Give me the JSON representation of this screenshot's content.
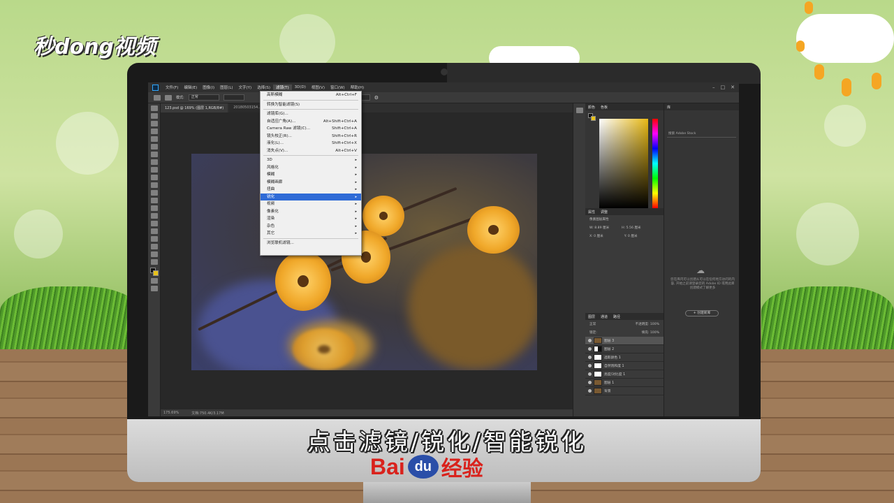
{
  "brand": {
    "watermark": "秒dong视频"
  },
  "ps": {
    "menubar": [
      "文件(F)",
      "编辑(E)",
      "图像(I)",
      "图层(L)",
      "文字(Y)",
      "选择(S)",
      "滤镜(T)",
      "3D(D)",
      "视图(V)",
      "窗口(W)",
      "帮助(H)"
    ],
    "active_menu": "滤镜(T)",
    "mode_label": "模式:",
    "mode_value": "正常",
    "tabs": [
      "123.psd @ 169% (图层 1,RGB/8#)",
      "20180503154..."
    ],
    "status_zoom": "175.69%",
    "status_doc": "文档:750.4K/3.17M"
  },
  "filter_menu": {
    "items": [
      {
        "label": "高斯模糊",
        "shortcut": "Alt+Ctrl+F"
      },
      {
        "sep": true
      },
      {
        "label": "转换为智能滤镜(S)",
        "shortcut": ""
      },
      {
        "sep": true
      },
      {
        "label": "滤镜库(G)...",
        "shortcut": ""
      },
      {
        "label": "自适应广角(A)...",
        "shortcut": "Alt+Shift+Ctrl+A"
      },
      {
        "label": "Camera Raw 滤镜(C)...",
        "shortcut": "Shift+Ctrl+A"
      },
      {
        "label": "镜头校正(R)...",
        "shortcut": "Shift+Ctrl+R"
      },
      {
        "label": "液化(L)...",
        "shortcut": "Shift+Ctrl+X"
      },
      {
        "label": "消失点(V)...",
        "shortcut": "Alt+Ctrl+V"
      },
      {
        "sep": true
      },
      {
        "label": "3D",
        "submenu": true
      },
      {
        "label": "风格化",
        "submenu": true
      },
      {
        "label": "模糊",
        "submenu": true
      },
      {
        "label": "模糊画廊",
        "submenu": true
      },
      {
        "label": "扭曲",
        "submenu": true
      },
      {
        "label": "锐化",
        "submenu": true,
        "highlighted": true
      },
      {
        "label": "视频",
        "submenu": true
      },
      {
        "label": "像素化",
        "submenu": true
      },
      {
        "label": "渲染",
        "submenu": true
      },
      {
        "label": "杂色",
        "submenu": true
      },
      {
        "label": "其它",
        "submenu": true
      },
      {
        "sep": true
      },
      {
        "label": "浏览联机滤镜...",
        "shortcut": ""
      }
    ]
  },
  "panels": {
    "color_tabs": [
      "颜色",
      "色板"
    ],
    "props_tabs": [
      "属性",
      "调整"
    ],
    "props_title": "像素图层属性",
    "props_w": "W: 8.89 厘米",
    "props_h": "H: 5.56 厘米",
    "props_x": "X: 0 厘米",
    "props_y": "Y: 0 厘米",
    "layers_tabs": [
      "图层",
      "通道",
      "路径"
    ],
    "blend_mode": "正常",
    "opacity": "不透明度: 100%",
    "fill": "填充: 100%",
    "lock": "锁定:",
    "layers": [
      {
        "name": "图层 3",
        "thumb": "photo",
        "selected": true
      },
      {
        "name": "图层 2",
        "thumb": "mask"
      },
      {
        "name": "选取颜色 1",
        "thumb": "white"
      },
      {
        "name": "自然饱和度 1",
        "thumb": "white"
      },
      {
        "name": "亮度/对比度 1",
        "thumb": "white"
      },
      {
        "name": "图层 1",
        "thumb": "photo"
      },
      {
        "name": "背景",
        "thumb": "photo"
      }
    ],
    "lib_tabs": [
      "库"
    ],
    "lib_search": "搜索 Adobe Stock",
    "lib_text": "您在库内可以创建从可以在任何地方访问的内容, 开始之前请登录您的 Adobe ID 或用此库创建模式了解更多",
    "lib_button": "+ 创建新库"
  },
  "subtitle": "点击滤镜/锐化/智能锐化",
  "footer": {
    "baidu": "Bai",
    "du": "du",
    "jingyan": "经验"
  }
}
